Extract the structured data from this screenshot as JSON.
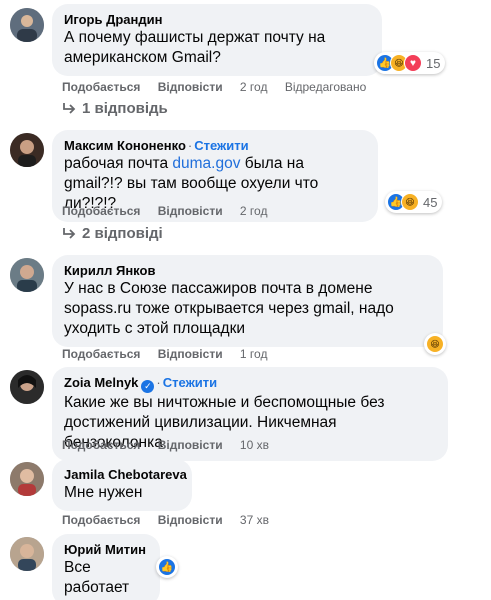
{
  "comments": [
    {
      "author": "Игорь Драндин",
      "text": "А почему фашисты держат почту на американском Gmail?",
      "like": "Подобається",
      "reply": "Відповісти",
      "time": "2 год",
      "edited": "Відредаговано",
      "reactions_count": "15",
      "replies": "1 відповідь"
    },
    {
      "author": "Максим Кононенко",
      "follow": "Стежити",
      "text_before": "рабочая почта ",
      "text_link": "duma.gov",
      "text_after": " была на gmail?!? вы там вообще охуели что ли?!?!?",
      "like": "Подобається",
      "reply": "Відповісти",
      "time": "2 год",
      "reactions_count": "45",
      "replies": "2 відповіді"
    },
    {
      "author": "Кирилл Янков",
      "text": "У нас в Союзе пассажиров почта в домене sopass.ru тоже открывается через gmail, надо уходить с этой площадки",
      "like": "Подобається",
      "reply": "Відповісти",
      "time": "1 год"
    },
    {
      "author": "Zoia Melnyk",
      "follow": "Стежити",
      "text": "Какие же вы ничтожные и беспомощные без достижений цивилизации. Никчемная бензоколонка",
      "like": "Подобається",
      "reply": "Відповісти",
      "time": "10 хв"
    },
    {
      "author": "Jamila Chebotareva",
      "text": "Мне нужен",
      "like": "Подобається",
      "reply": "Відповісти",
      "time": "37 хв"
    },
    {
      "author": "Юрий Митин",
      "text": "Все работает"
    }
  ],
  "colors": {
    "bubble": "#f0f2f5",
    "link": "#1b74e4",
    "meta": "#65676b",
    "like_reaction": "#1b74e4",
    "haha_reaction": "#f7b125",
    "love_reaction": "#f33e58"
  }
}
